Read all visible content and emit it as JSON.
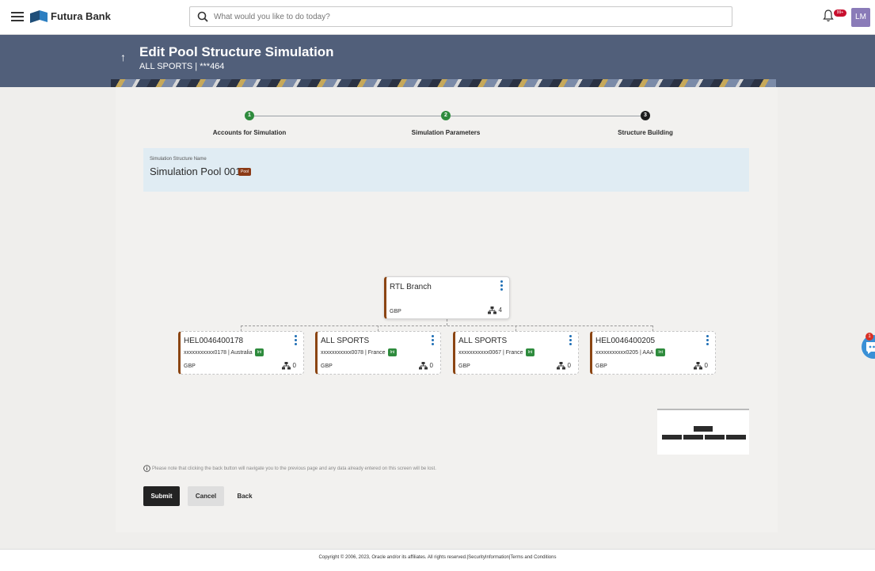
{
  "header": {
    "brand": "Futura Bank",
    "search_placeholder": "What would you like to do today?",
    "notification_count": "99+",
    "avatar_initials": "LM",
    "icons": [
      "menu-icon",
      "bank-logo-icon",
      "search-icon",
      "bell-icon"
    ]
  },
  "banner": {
    "title": "Edit Pool Structure Simulation",
    "subtitle": "ALL SPORTS | ***464"
  },
  "stepper": {
    "steps": [
      {
        "number": "1",
        "label": "Accounts for Simulation",
        "status": "done"
      },
      {
        "number": "2",
        "label": "Simulation Parameters",
        "status": "done"
      },
      {
        "number": "3",
        "label": "Structure Building",
        "status": "active"
      }
    ]
  },
  "simulation": {
    "label": "Simulation Structure Name",
    "name": "Simulation Pool 001",
    "badge": "Pool"
  },
  "tree": {
    "root": {
      "title": "RTL Branch",
      "currency": "GBP",
      "count": "4"
    },
    "children": [
      {
        "title": "HEL0046400178",
        "account": "xxxxxxxxxxx0178 | Australia",
        "badge": "Int",
        "currency": "GBP",
        "count": "0"
      },
      {
        "title": "ALL SPORTS",
        "account": "xxxxxxxxxxx0078 | France",
        "badge": "Int",
        "currency": "GBP",
        "count": "0"
      },
      {
        "title": "ALL SPORTS",
        "account": "xxxxxxxxxxx0067 | France",
        "badge": "Int",
        "currency": "GBP",
        "count": "0"
      },
      {
        "title": "HEL0046400205",
        "account": "xxxxxxxxxxx0205 | AAA",
        "badge": "Int",
        "currency": "GBP",
        "count": "0"
      }
    ]
  },
  "note": "Please note that clicking the back button will navigate you to the previous page and any data already entered on this screen will be lost.",
  "actions": {
    "submit": "Submit",
    "cancel": "Cancel",
    "back": "Back"
  },
  "chat_badge": "1",
  "footer": "Copyright © 2006, 2023, Oracle and/or its affiliates. All rights reserved.|SecurityInformation|Terms and Conditions",
  "colors": {
    "banner": "#515f7a",
    "step_done": "#2e8b3d",
    "node_accent": "#8b4513",
    "pool_badge": "#8b3a16",
    "primary_button": "#232323"
  }
}
